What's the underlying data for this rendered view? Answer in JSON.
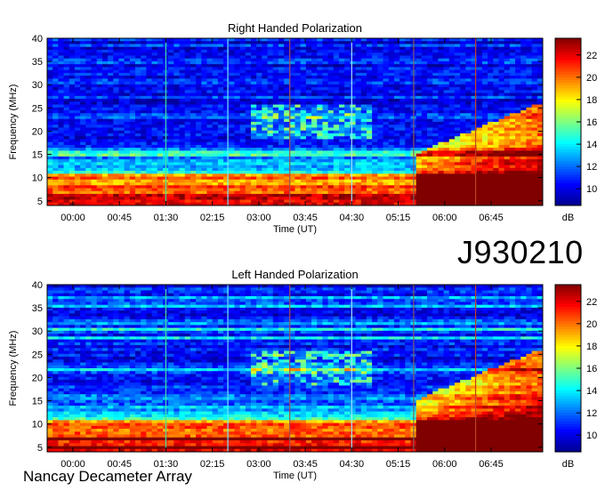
{
  "observation_id": "J930210",
  "observatory": "Nancay Decameter Array",
  "chart_data": [
    {
      "type": "heatmap",
      "title": "Right Handed Polarization",
      "xlabel": "Time (UT)",
      "ylabel": "Frequency (MHz)",
      "ylim": [
        4,
        40
      ],
      "yticks": [
        5,
        10,
        15,
        20,
        25,
        30,
        35,
        40
      ],
      "xticks": [
        "00:00",
        "00:45",
        "01:30",
        "02:15",
        "03:00",
        "03:45",
        "04:30",
        "05:15",
        "06:00",
        "06:45"
      ],
      "colorbar": {
        "label": "dB",
        "range": [
          8.5,
          23.5
        ],
        "ticks": [
          10,
          12,
          14,
          16,
          18,
          20,
          22
        ]
      },
      "colormap": [
        "#00008f",
        "#0000ff",
        "#0080ff",
        "#00ffff",
        "#80ff80",
        "#ffff00",
        "#ff8000",
        "#ff0000",
        "#800000"
      ],
      "marker_lines": [
        {
          "time": "01:30",
          "color": "#40e0a0"
        },
        {
          "time": "02:30",
          "color": "#70e8ff"
        },
        {
          "time": "03:30",
          "color": "#a05050"
        },
        {
          "time": "04:30",
          "color": "#a0e0ff"
        },
        {
          "time": "05:30",
          "color": "#806060"
        },
        {
          "time": "06:30",
          "color": "#c04020"
        }
      ]
    },
    {
      "type": "heatmap",
      "title": "Left Handed Polarization",
      "xlabel": "Time (UT)",
      "ylabel": "Frequency (MHz)",
      "ylim": [
        4,
        40
      ],
      "yticks": [
        5,
        10,
        15,
        20,
        25,
        30,
        35,
        40
      ],
      "xticks": [
        "00:00",
        "00:45",
        "01:30",
        "02:15",
        "03:00",
        "03:45",
        "04:30",
        "05:15",
        "06:00",
        "06:45"
      ],
      "colorbar": {
        "label": "dB",
        "range": [
          8.5,
          23.5
        ],
        "ticks": [
          10,
          12,
          14,
          16,
          18,
          20,
          22
        ]
      },
      "colormap": [
        "#00008f",
        "#0000ff",
        "#0080ff",
        "#00ffff",
        "#80ff80",
        "#ffff00",
        "#ff8000",
        "#ff0000",
        "#800000"
      ],
      "marker_lines": [
        {
          "time": "01:30",
          "color": "#40e0a0"
        },
        {
          "time": "02:30",
          "color": "#70e8ff"
        },
        {
          "time": "03:30",
          "color": "#a05050"
        },
        {
          "time": "04:30",
          "color": "#a0e0ff"
        },
        {
          "time": "05:30",
          "color": "#806060"
        },
        {
          "time": "06:30",
          "color": "#c04020"
        }
      ]
    }
  ]
}
